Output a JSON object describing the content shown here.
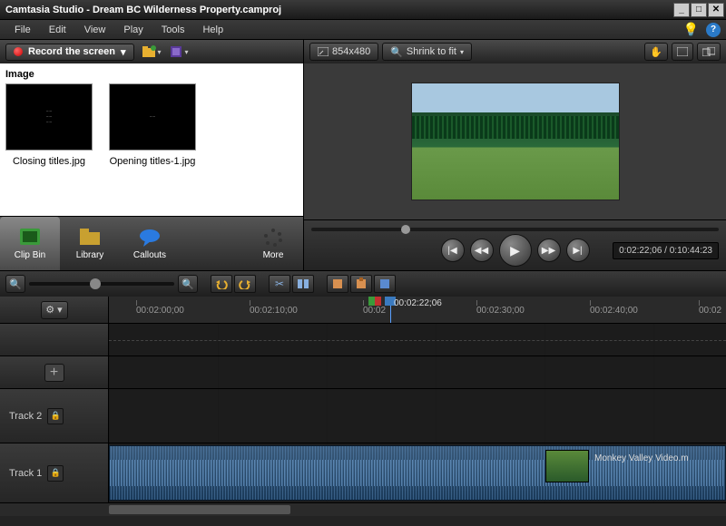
{
  "title": "Camtasia Studio - Dream BC Wilderness Property.camproj",
  "menu": {
    "file": "File",
    "edit": "Edit",
    "view": "View",
    "play": "Play",
    "tools": "Tools",
    "help": "Help"
  },
  "record_btn": "Record the screen",
  "clipbin": {
    "heading": "Image",
    "items": [
      {
        "label": "Closing titles.jpg"
      },
      {
        "label": "Opening titles-1.jpg"
      }
    ]
  },
  "tabs": {
    "clipbin": "Clip Bin",
    "library": "Library",
    "callouts": "Callouts",
    "more": "More"
  },
  "preview": {
    "dimensions": "854x480",
    "zoom_label": "Shrink to fit",
    "timecode": "0:02:22;06 / 0:10:44:23"
  },
  "timeline": {
    "ruler": [
      "00:02:00;00",
      "00:02:10;00",
      "00:02",
      "00:02:22;06",
      "00:02:30;00",
      "00:02:40;00",
      "00:02"
    ],
    "tracks": {
      "t2": "Track 2",
      "t1": "Track 1"
    },
    "clip_label": "Monkey Valley Video.m"
  }
}
